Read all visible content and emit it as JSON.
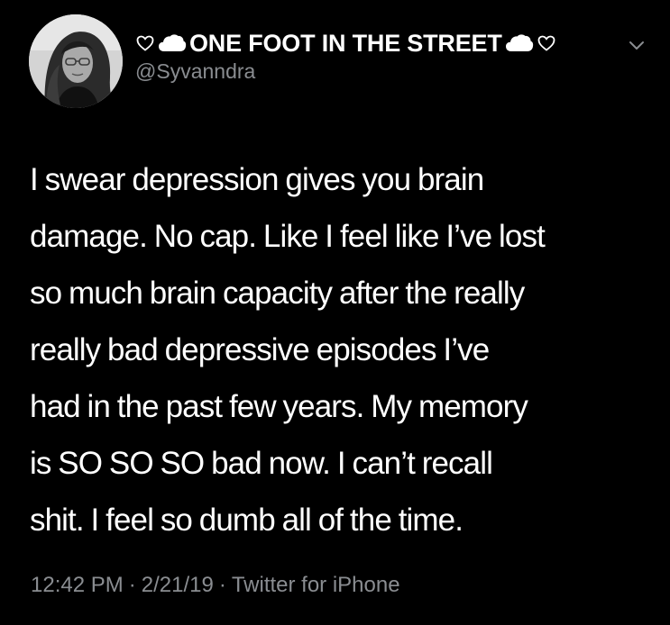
{
  "author": {
    "display_name": "ONE FOOT IN THE STREET",
    "handle": "@Syvanndra",
    "name_decorations": {
      "left": [
        "white-heart-icon",
        "cloud-icon"
      ],
      "right": [
        "cloud-icon",
        "white-heart-icon"
      ]
    },
    "avatar": "profile-photo"
  },
  "tweet": {
    "lines": [
      "I swear depression gives you brain",
      "damage. No cap. Like I feel like I’ve lost",
      "so much brain capacity after the really",
      "really bad depressive episodes I’ve",
      "had in the past few years. My memory",
      "is SO SO SO bad now. I can’t recall",
      "shit. I feel so dumb all of the time."
    ]
  },
  "meta": {
    "time": "12:42 PM",
    "date": "2/21/19",
    "source": "Twitter for iPhone",
    "separator": "·"
  },
  "icons": {
    "menu": "chevron-down-icon"
  },
  "colors": {
    "background": "#000000",
    "text": "#ffffff",
    "secondary_text": "#8a8d91"
  }
}
